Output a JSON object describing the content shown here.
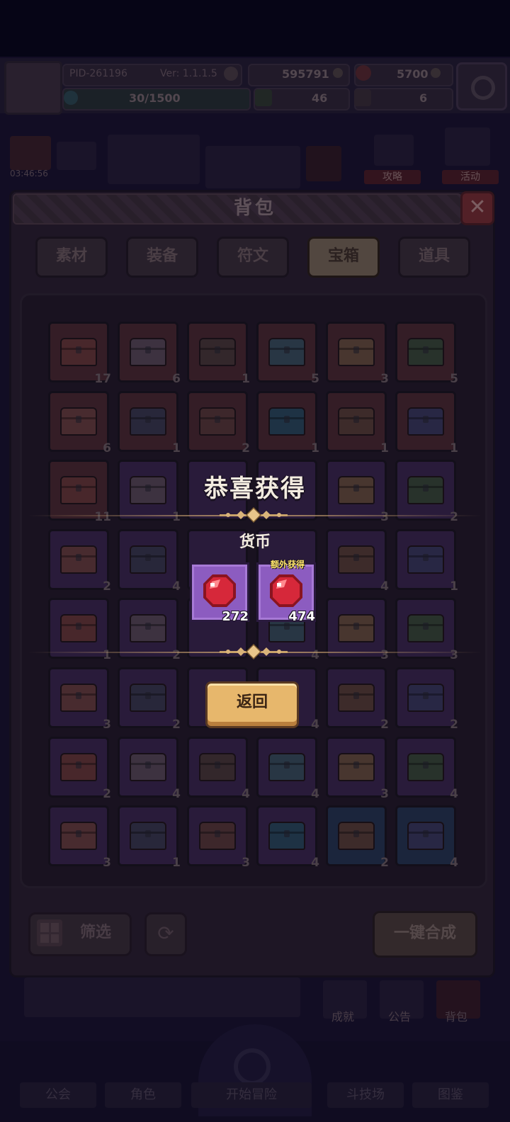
{
  "top_status": {
    "pid": "PID-261196",
    "version": "Ver: 1.1.1.5",
    "gold": "595791",
    "gems": "5700",
    "energy": "30/1500",
    "clover_count": "46",
    "key_count": "6",
    "timer": "03:46:56"
  },
  "scene": {
    "strategy_label": "攻略",
    "event_label": "活动",
    "achievement_label": "成就",
    "notice_label": "公告",
    "bag_label": "背包"
  },
  "bottom_nav": {
    "items": [
      "公会",
      "角色",
      "开始冒险",
      "斗技场",
      "图鉴"
    ]
  },
  "panel": {
    "title": "背包",
    "tabs": [
      "素材",
      "装备",
      "符文",
      "宝箱",
      "道具"
    ],
    "active_tab": "宝箱",
    "filter_label": "筛选",
    "merge_label": "一键合成",
    "slot_quantities": [
      [
        "17",
        "6",
        "1",
        "5",
        "3",
        "5"
      ],
      [
        "6",
        "1",
        "2",
        "1",
        "1",
        "1"
      ],
      [
        "11",
        "1",
        "",
        "",
        "3",
        "2"
      ],
      [
        "2",
        "4",
        "",
        "",
        "4",
        "1"
      ],
      [
        "1",
        "2",
        "",
        "4",
        "3",
        "3"
      ],
      [
        "3",
        "2",
        "",
        "4",
        "2",
        "2"
      ],
      [
        "2",
        "4",
        "4",
        "4",
        "3",
        "4"
      ],
      [
        "3",
        "1",
        "3",
        "4",
        "2",
        "4"
      ]
    ]
  },
  "reward_popup": {
    "title": "恭喜获得",
    "section_label": "货币",
    "items": [
      {
        "qty": "272",
        "icon": "red-gem-icon"
      },
      {
        "qty": "474",
        "icon": "red-gem-icon",
        "tag": "额外获得"
      }
    ],
    "back_label": "返回"
  },
  "colors": {
    "reward_card": "#8c5cc0",
    "gem_red": "#d6283a",
    "back_button": "#e7b76c",
    "extra_tag": "#ffe66a"
  }
}
